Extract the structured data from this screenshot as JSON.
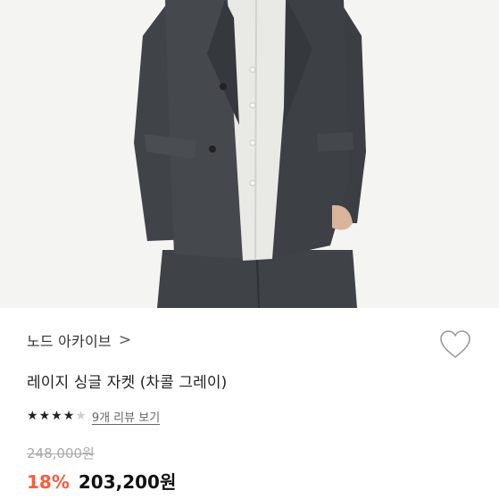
{
  "product": {
    "brand": "노드 아카이브",
    "brand_chevron": ">",
    "title": "레이지 싱글 자켓 (차콜 그레이)",
    "rating_stars_filled": 4,
    "rating_stars_total": 5,
    "review_text": "9개 리뷰 보기",
    "original_price": "248,000원",
    "discount": "18%",
    "final_price": "203,200원"
  },
  "icons": {
    "wishlist": "heart-outline-icon",
    "star_full": "star-filled-icon",
    "star_empty": "star-empty-icon"
  },
  "colors": {
    "discount": "#ff5a3c",
    "jacket": "#3e4145",
    "shirt": "#e9e9e6"
  }
}
